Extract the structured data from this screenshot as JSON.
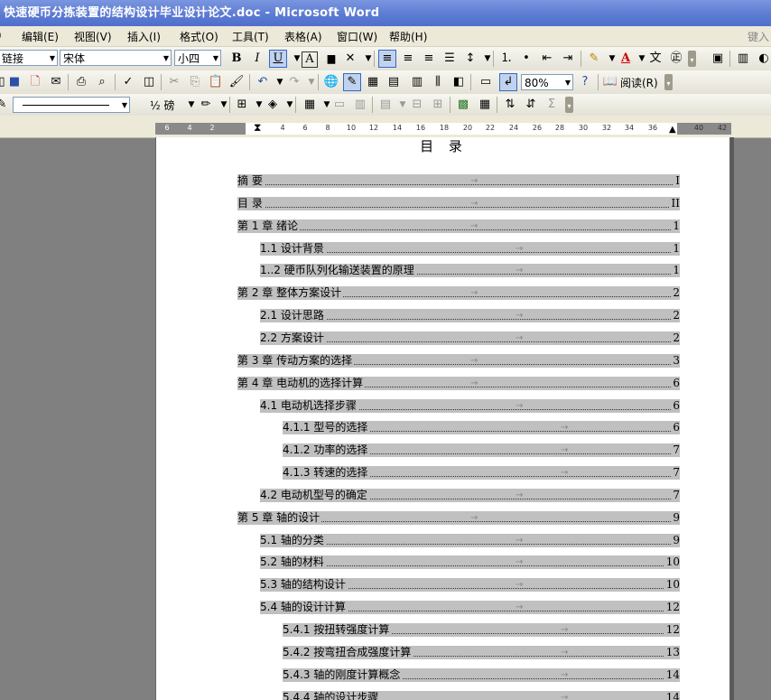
{
  "window": {
    "title": "快速硬币分拣装置的结构设计毕业设计论文.doc - Microsoft Word"
  },
  "menubar": {
    "items": [
      "编辑(E)",
      "视图(V)",
      "插入(I)",
      "格式(O)",
      "工具(T)",
      "表格(A)",
      "窗口(W)",
      "帮助(H)"
    ],
    "hint": "键入"
  },
  "toolbar": {
    "style_value": "链接",
    "font_value": "宋体",
    "size_value": "小四",
    "zoom_value": "80%",
    "read_label": "阅读(R)",
    "line_weight": "½ 磅",
    "bold": "B",
    "italic": "I",
    "underline": "U",
    "char_border": "A",
    "font_color": "A",
    "sigma": "Σ"
  },
  "ruler": {
    "left_ticks": [
      "6",
      "4",
      "2"
    ],
    "ticks": [
      "4",
      "6",
      "8",
      "10",
      "12",
      "14",
      "16",
      "18",
      "20",
      "22",
      "24",
      "26",
      "28",
      "30",
      "32",
      "34",
      "36",
      "40",
      "42"
    ]
  },
  "document": {
    "heading": "目 录",
    "toc": [
      {
        "title": "摘  要",
        "page": "I",
        "level": 0
      },
      {
        "title": "目  录",
        "page": "II",
        "level": 0
      },
      {
        "title": "第 1 章  绪论",
        "page": "1",
        "level": 0
      },
      {
        "title": "1.1 设计背景",
        "page": "1",
        "level": 1
      },
      {
        "title": "1..2  硬币队列化输送装置的原理",
        "page": "1",
        "level": 1
      },
      {
        "title": "第 2 章  整体方案设计",
        "page": "2",
        "level": 0
      },
      {
        "title": "2.1 设计思路",
        "page": "2",
        "level": 1
      },
      {
        "title": "2.2 方案设计",
        "page": "2",
        "level": 1
      },
      {
        "title": "第 3 章  传动方案的选择",
        "page": "3",
        "level": 0
      },
      {
        "title": "第 4 章  电动机的选择计算",
        "page": "6",
        "level": 0
      },
      {
        "title": "4.1 电动机选择步骤",
        "page": "6",
        "level": 1
      },
      {
        "title": "4.1.1 型号的选择",
        "page": "6",
        "level": 2
      },
      {
        "title": "4.1.2 功率的选择",
        "page": "7",
        "level": 2
      },
      {
        "title": "4.1.3  转速的选择",
        "page": "7",
        "level": 2
      },
      {
        "title": "4.2  电动机型号的确定",
        "page": "7",
        "level": 1
      },
      {
        "title": "第 5 章  轴的设计",
        "page": "9",
        "level": 0
      },
      {
        "title": "5.1  轴的分类",
        "page": "9",
        "level": 1
      },
      {
        "title": "5.2 轴的材料",
        "page": "10",
        "level": 1
      },
      {
        "title": "5.3 轴的结构设计",
        "page": "10",
        "level": 1
      },
      {
        "title": "5.4  轴的设计计算",
        "page": "12",
        "level": 1
      },
      {
        "title": "5.4.1  按扭转强度计算",
        "page": "12",
        "level": 2
      },
      {
        "title": "5.4.2  按弯扭合成强度计算",
        "page": "13",
        "level": 2
      },
      {
        "title": "5.4.3  轴的刚度计算概念",
        "page": "14",
        "level": 2
      },
      {
        "title": "5.4.4  轴的设计步骤",
        "page": "14",
        "level": 2
      }
    ]
  }
}
